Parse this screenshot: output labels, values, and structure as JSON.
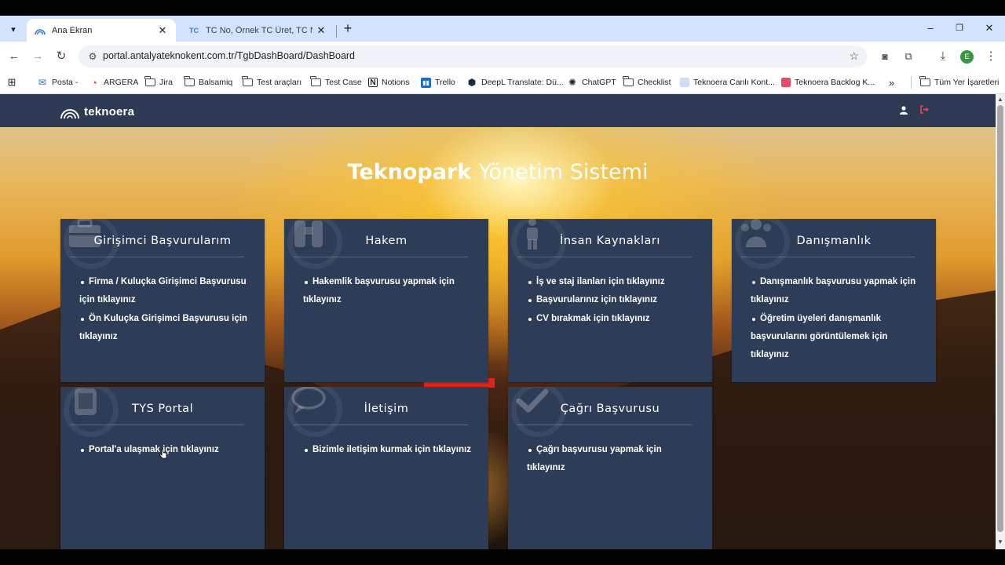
{
  "browser": {
    "tabs": [
      {
        "title": "Ana Ekran",
        "active": true
      },
      {
        "title": "TC No, Örnek TC Üret, TC Numa",
        "active": false
      }
    ],
    "url": "portal.antalyateknokent.com.tr/TgbDashBoard/DashBoard",
    "profile_initial": "E",
    "bookmarks": [
      {
        "label": "Posta -",
        "icon": "mail-icon"
      },
      {
        "label": "ARGERA",
        "icon": "argera-icon"
      },
      {
        "label": "Jira",
        "icon": "folder-icon"
      },
      {
        "label": "Balsamiq",
        "icon": "folder-icon"
      },
      {
        "label": "Test araçları",
        "icon": "folder-icon"
      },
      {
        "label": "Test Case",
        "icon": "folder-icon"
      },
      {
        "label": "Notions",
        "icon": "notion-icon"
      },
      {
        "label": "Trello",
        "icon": "trello-icon"
      },
      {
        "label": "DeepL Translate: Dü...",
        "icon": "deepl-icon"
      },
      {
        "label": "ChatGPT",
        "icon": "chatgpt-icon"
      },
      {
        "label": "Checklist",
        "icon": "folder-icon"
      },
      {
        "label": "Teknoera Canlı Kont...",
        "icon": "page-icon"
      },
      {
        "label": "Teknoera Backlog K...",
        "icon": "page-icon"
      }
    ],
    "all_bookmarks_label": "Tüm Yer İşaretleri"
  },
  "site": {
    "logo_text": "teknoera",
    "hero_bold": "Teknopark",
    "hero_light": "Yönetim Sistemi"
  },
  "cards": [
    {
      "title": "Girişimci Başvurularım",
      "icon": "briefcase-icon",
      "items": [
        "Firma / Kuluçka Girişimci Başvurusu için tıklayınız",
        "Ön Kuluçka Girişimci Başvurusu için tıklayınız"
      ]
    },
    {
      "title": "Hakem",
      "icon": "binoculars-icon",
      "items": [
        "Hakemlik başvurusu yapmak için tıklayınız"
      ]
    },
    {
      "title": "İnsan Kaynakları",
      "icon": "person-icon",
      "items": [
        "İş ve staj ilanları için tıklayınız",
        "Başvurularınız için tıklayınız",
        "CV bırakmak için tıklayınız"
      ]
    },
    {
      "title": "Danışmanlık",
      "icon": "users-icon",
      "items": [
        "Danışmanlık başvurusu yapmak için tıklayınız",
        "Öğretim üyeleri danışmanlık başvurularını görüntülemek için tıklayınız"
      ]
    },
    {
      "title": "TYS Portal",
      "icon": "tablet-icon",
      "items": [
        "Portal'a ulaşmak için tıklayınız"
      ]
    },
    {
      "title": "İletişim",
      "icon": "chat-icon",
      "items": [
        "Bizimle iletişim kurmak için tıklayınız"
      ]
    },
    {
      "title": "Çağrı Başvurusu",
      "icon": "check-icon",
      "items": [
        "Çağrı başvurusu yapmak için tıklayınız"
      ]
    }
  ],
  "colors": {
    "header_bg": "#2e3a54",
    "card_bg": "#2e3d57",
    "logout_accent": "#e8454a",
    "tabbar_bg": "#d3e3fd"
  }
}
